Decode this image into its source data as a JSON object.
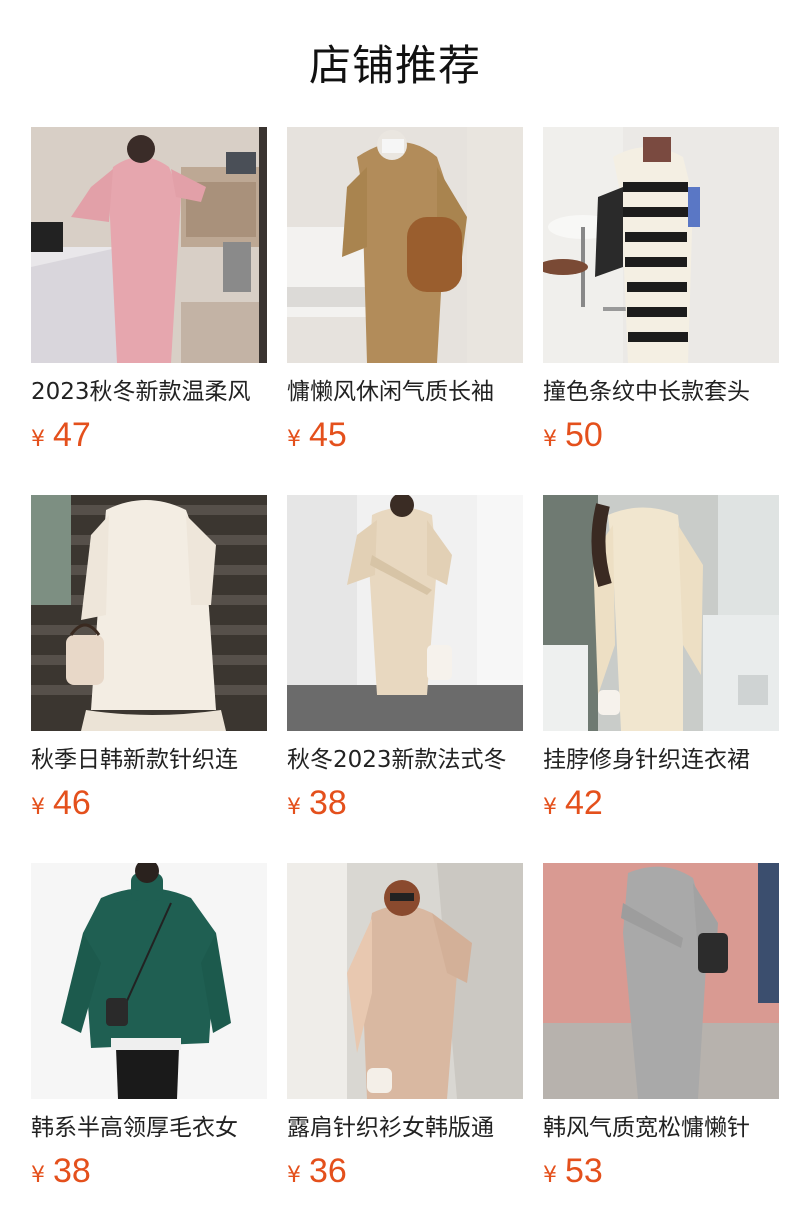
{
  "section": {
    "title": "店铺推荐"
  },
  "currency_symbol": "¥",
  "products": [
    {
      "name": "2023秋冬新款温柔风",
      "price": "47",
      "image": "pink-knit-dress-photo"
    },
    {
      "name": "慵懒风休闲气质长袖",
      "price": "45",
      "image": "camel-hooded-dress-photo"
    },
    {
      "name": "撞色条纹中长款套头",
      "price": "50",
      "image": "striped-knit-dress-photo"
    },
    {
      "name": "秋季日韩新款针织连",
      "price": "46",
      "image": "cream-ruffle-dress-photo"
    },
    {
      "name": "秋冬2023新款法式冬",
      "price": "38",
      "image": "beige-wrap-dress-photo"
    },
    {
      "name": "挂脖修身针织连衣裙",
      "price": "42",
      "image": "halter-knit-dress-photo"
    },
    {
      "name": "韩系半高领厚毛衣女",
      "price": "38",
      "image": "green-sweater-photo"
    },
    {
      "name": "露肩针织衫女韩版通",
      "price": "36",
      "image": "cold-shoulder-knit-photo"
    },
    {
      "name": "韩风气质宽松慵懒针",
      "price": "53",
      "image": "grey-knit-dress-photo"
    }
  ],
  "colors": {
    "price": "#e4501c",
    "title": "#111111",
    "name": "#222222"
  }
}
